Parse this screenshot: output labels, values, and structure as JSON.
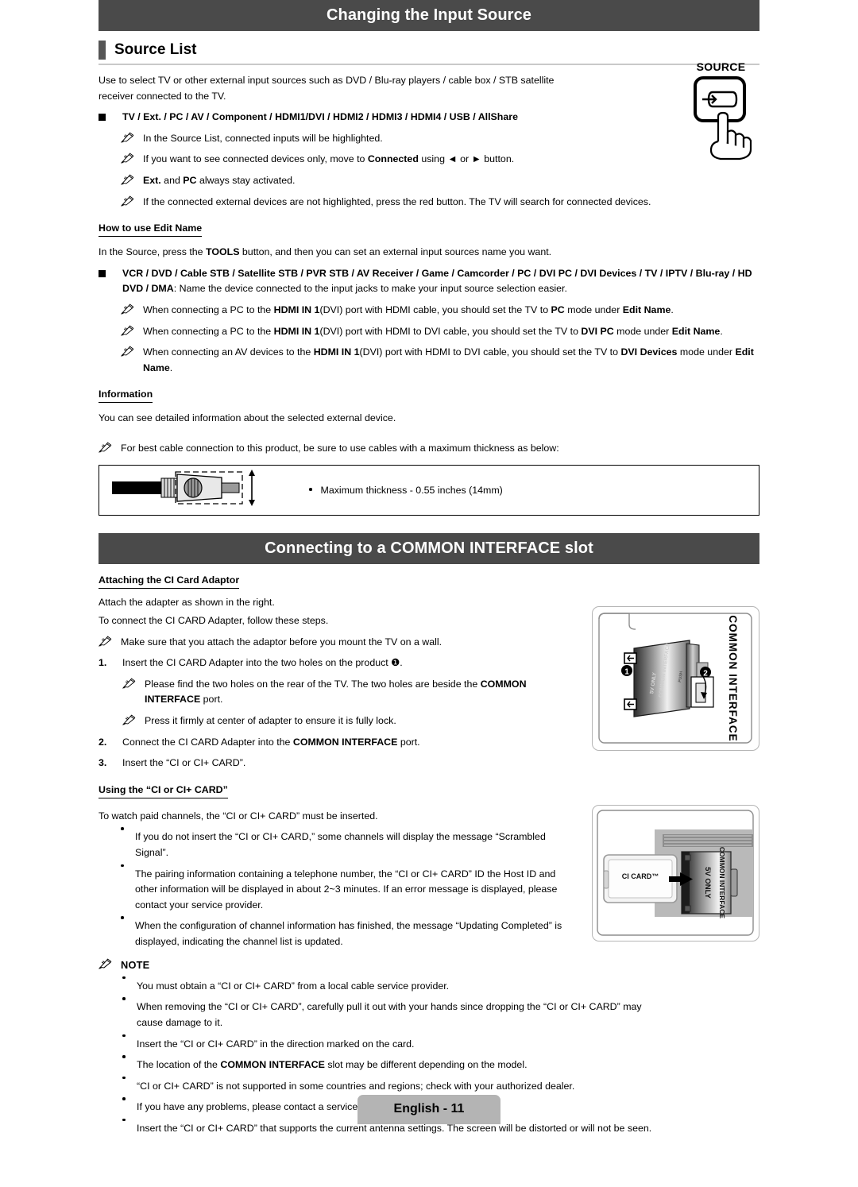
{
  "document": {
    "footer_page_label": "English - 11"
  },
  "section1": {
    "banner_title": "Changing the Input Source",
    "subhead": "Source List",
    "intro": "Use to select TV or other external input sources such as DVD / Blu-ray players / cable box / STB satellite receiver connected to the TV.",
    "source_list_line": "TV / Ext. / PC / AV / Component / HDMI1/DVI / HDMI2 / HDMI3 / HDMI4 / USB / AllShare",
    "notes": [
      "In the Source List, connected inputs will be highlighted.",
      "If you want to see connected devices only, move to Connected using ◄ or ► button.",
      "Ext. and PC always stay activated.",
      "If the connected external devices are not highlighted, press the red button. The TV will search for connected devices."
    ],
    "edit_name": {
      "heading": "How to use Edit Name",
      "intro": "In the Source, press the TOOLS button, and then you can set an external input sources name you want.",
      "device_list_bold": "VCR / DVD / Cable STB / Satellite STB / PVR STB / AV Receiver / Game / Camcorder / PC / DVI PC / DVI Devices / TV / IPTV / Blu-ray / HD DVD / DMA",
      "device_list_rest": ": Name the device connected to the input jacks to make your input source selection easier.",
      "notes": [
        "When connecting a PC to the HDMI IN 1(DVI) port with HDMI cable, you should set the TV to PC mode under Edit Name.",
        "When connecting a PC to the HDMI IN 1(DVI) port with HDMI to DVI cable, you should set the TV to DVI PC mode under Edit Name.",
        "When connecting an AV devices to the HDMI IN 1(DVI) port with HDMI to DVI cable, you should set the TV to DVI Devices mode under Edit Name."
      ]
    },
    "information": {
      "heading": "Information",
      "text": "You can see detailed information about the selected external device."
    },
    "cable_note": "For best cable connection to this product, be sure to use cables with a maximum thickness as below:",
    "cable_box_bullet": "Maximum thickness - 0.55 inches (14mm)",
    "remote_figure": {
      "label": "SOURCE",
      "button_icon": "source-input-icon",
      "hand_icon": "pointing-hand-icon"
    }
  },
  "section2": {
    "banner_title": "Connecting to a COMMON INTERFACE slot",
    "attaching": {
      "heading": "Attaching the CI Card Adaptor",
      "line1": "Attach the adapter as shown in the right.",
      "line2": "To connect the CI CARD Adapter, follow these steps.",
      "note1": "Make sure that you attach the adaptor before you mount the TV on a wall.",
      "step1": "Insert the CI CARD Adapter into the two holes on the product ❶.",
      "step1_num": "1.",
      "step1_note1": "Please find the two holes on the rear of the TV. The two holes are beside the COMMON INTERFACE port.",
      "step1_note2": "Press it firmly at center of adapter to ensure it is fully lock.",
      "step2_num": "2.",
      "step2": "Connect the CI CARD Adapter into the COMMON INTERFACE port.",
      "step3_num": "3.",
      "step3": "Insert the “CI or CI+ CARD”."
    },
    "using": {
      "heading": "Using the “CI or CI+ CARD”",
      "intro": "To watch paid channels, the “CI or CI+ CARD” must be inserted.",
      "bullets": [
        "If you do not insert the “CI or CI+ CARD,” some channels will display the message “Scrambled Signal”.",
        "The pairing information containing a telephone number, the “CI or CI+ CARD” ID the Host ID and other information will be displayed in about 2~3 minutes. If an error message is displayed, please contact your service provider.",
        "When the configuration of channel information has finished, the message “Updating Completed” is displayed, indicating the channel list is updated."
      ]
    },
    "note": {
      "title": "NOTE",
      "items": [
        "You must obtain a “CI or CI+ CARD” from a local cable service provider.",
        "When removing the “CI or CI+ CARD”, carefully pull it out with your hands since dropping the “CI or CI+ CARD” may cause damage to it.",
        "Insert the “CI or CI+ CARD” in the direction marked on the card.",
        "The location of the COMMON INTERFACE slot may be different depending on the model.",
        "“CI or CI+ CARD” is not supported in some countries and regions; check with your authorized dealer.",
        "If you have any problems, please contact a service provider.",
        "Insert the “CI or CI+ CARD” that supports the current antenna settings. The screen will be distorted or will not be seen."
      ]
    },
    "adaptor_figure": {
      "side_label": "COMMON INTERFACE",
      "card_label_1": "5V ONLY",
      "card_label_2": "COMMON INTERFACE",
      "callout_1": "❶",
      "callout_2": "❷"
    },
    "card_figure": {
      "card_label": "CI CARD™",
      "slot_label_1": "5V ONLY",
      "slot_label_2": "COMMON INTERFACE"
    }
  },
  "colors": {
    "banner_bg": "#4a4a4a",
    "tab_bg": "#555555",
    "rule": "#c9c9c9",
    "footer_bg": "#b4b4b4"
  }
}
